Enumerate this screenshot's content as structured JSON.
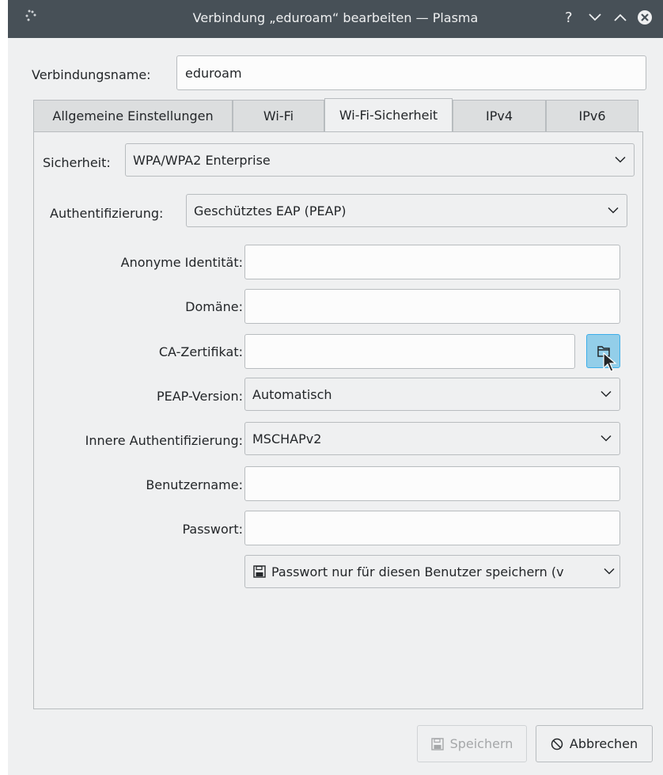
{
  "window": {
    "title": "Verbindung „eduroam“ bearbeiten — Plasma"
  },
  "connection_name": {
    "label": "Verbindungsname:",
    "value": "eduroam"
  },
  "tabs": [
    {
      "label": "Allgemeine Einstellungen"
    },
    {
      "label": "Wi-Fi"
    },
    {
      "label": "Wi-Fi-Sicherheit"
    },
    {
      "label": "IPv4"
    },
    {
      "label": "IPv6"
    }
  ],
  "security": {
    "label": "Sicherheit:",
    "value": "WPA/WPA2 Enterprise"
  },
  "authentication": {
    "label": "Authentifizierung:",
    "value": "Geschütztes EAP (PEAP)"
  },
  "anonymous_identity": {
    "label": "Anonyme Identität:",
    "value": ""
  },
  "domain": {
    "label": "Domäne:",
    "value": ""
  },
  "ca_certificate": {
    "label": "CA-Zertifikat:",
    "value": ""
  },
  "peap_version": {
    "label": "PEAP-Version:",
    "value": "Automatisch"
  },
  "inner_auth": {
    "label": "Innere Authentifizierung:",
    "value": "MSCHAPv2"
  },
  "username": {
    "label": "Benutzername:",
    "value": ""
  },
  "password": {
    "label": "Passwort:",
    "value": ""
  },
  "password_storage": {
    "value": "Passwort nur für diesen Benutzer speichern (v"
  },
  "buttons": {
    "save": "Speichern",
    "cancel": "Abbrechen"
  },
  "colors": {
    "titlebar": "#475057",
    "window_bg": "#eff0f1",
    "accent": "#3daee9"
  }
}
